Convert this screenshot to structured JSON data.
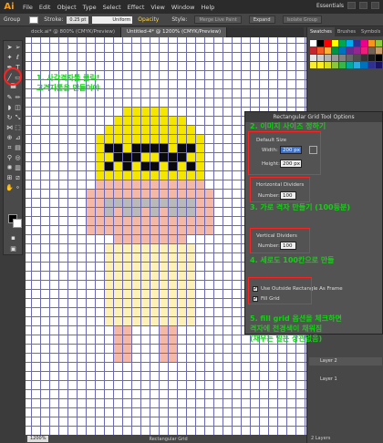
{
  "menubar": {
    "logo": "Ai",
    "items": [
      "File",
      "Edit",
      "Object",
      "Type",
      "Select",
      "Effect",
      "View",
      "Window",
      "Help"
    ],
    "workspace": "Essentials"
  },
  "controlbar": {
    "group_label": "Group",
    "stroke_label": "Stroke:",
    "stroke_value": "0.25 pt",
    "stroke_profile": "Uniform",
    "opacity_label": "Opacity",
    "style_label": "Style:",
    "merge_live_paint": "Merge Live Paint",
    "expand": "Expand",
    "isolate_group": "Isolate Group"
  },
  "tabs": [
    {
      "label": "dock.ai* @ 800% (CMYK/Preview)",
      "active": false
    },
    {
      "label": "Untitled-4* @ 1200% (CMYK/Preview)",
      "active": true
    }
  ],
  "panel": {
    "tabs": [
      "Swatches",
      "Brushes",
      "Symbols"
    ],
    "layers": [
      "Layer 2",
      "Layer 1"
    ],
    "layer_count": "2 Layers"
  },
  "status": {
    "zoom": "1200%",
    "tool": "Rectangular Grid"
  },
  "dialog": {
    "title": "Rectangular Grid Tool Options",
    "default_size_label": "Default Size",
    "width_label": "Width:",
    "width_value": "200 px",
    "height_label": "Height:",
    "height_value": "200 px",
    "horizontal_label": "Horizontal Dividers",
    "horizontal_number_label": "Number:",
    "horizontal_number": "100",
    "vertical_label": "Vertical Dividers",
    "vertical_number_label": "Number:",
    "vertical_number": "100",
    "use_outside_label": "Use Outside Rectangle As Frame",
    "fill_grid_label": "Fill Grid",
    "checkmark": "✔"
  },
  "annotations": {
    "step1_line1": "1. 사각격자툴 클릭!",
    "step1_line2": "고격자툴을 만들어야",
    "step2": "2. 이미지 사이즈 정하기",
    "step3": "3. 가로 격자 만들기 (100등분)",
    "step4": "4. 세로도 100칸으로 만들",
    "step5_line1": "5. fill grid 옵션을 체크하면",
    "step5_line2": "격자에 전경색이 채워짐",
    "step5_line3": "(채우는 말든 상관없음)"
  },
  "colors": {
    "grid_line": "#6a68b8",
    "hair": "#f5e600",
    "glasses": "#0a0a0a",
    "skin": "#f4b9a6",
    "teeth": "#b9b9b9",
    "body": "#fdf1b8",
    "annotation": "#14d014",
    "highlight": "#ff2020"
  }
}
